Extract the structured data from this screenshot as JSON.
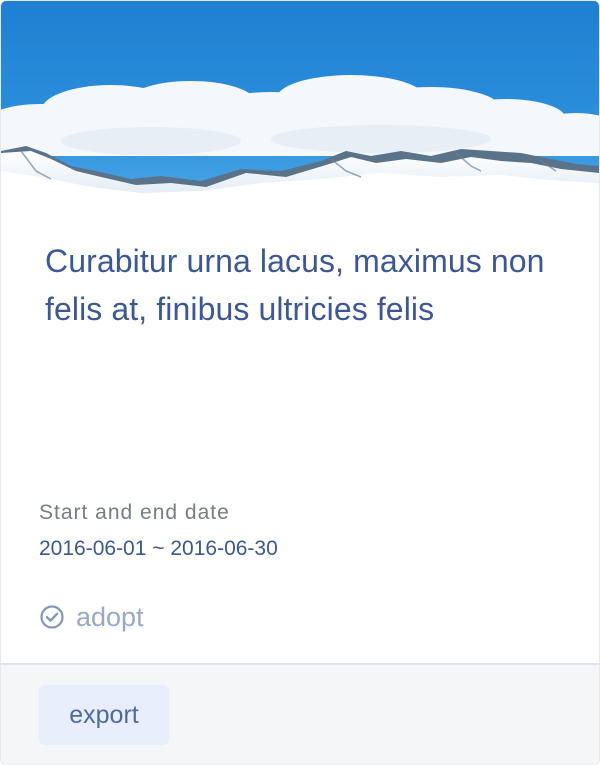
{
  "card": {
    "title": "Curabitur urna lacus, maximus non felis at, finibus ultricies felis",
    "date_label": "Start and end date",
    "date_value": "2016-06-01 ~ 2016-06-30",
    "status": {
      "icon": "check-circle-icon",
      "label": "adopt"
    },
    "export_label": "export"
  },
  "colors": {
    "title": "#3b5895",
    "label": "#777c85",
    "status": "#9aa8c5",
    "button_bg": "#e8eefb",
    "footer_bg": "#f5f6f8"
  }
}
